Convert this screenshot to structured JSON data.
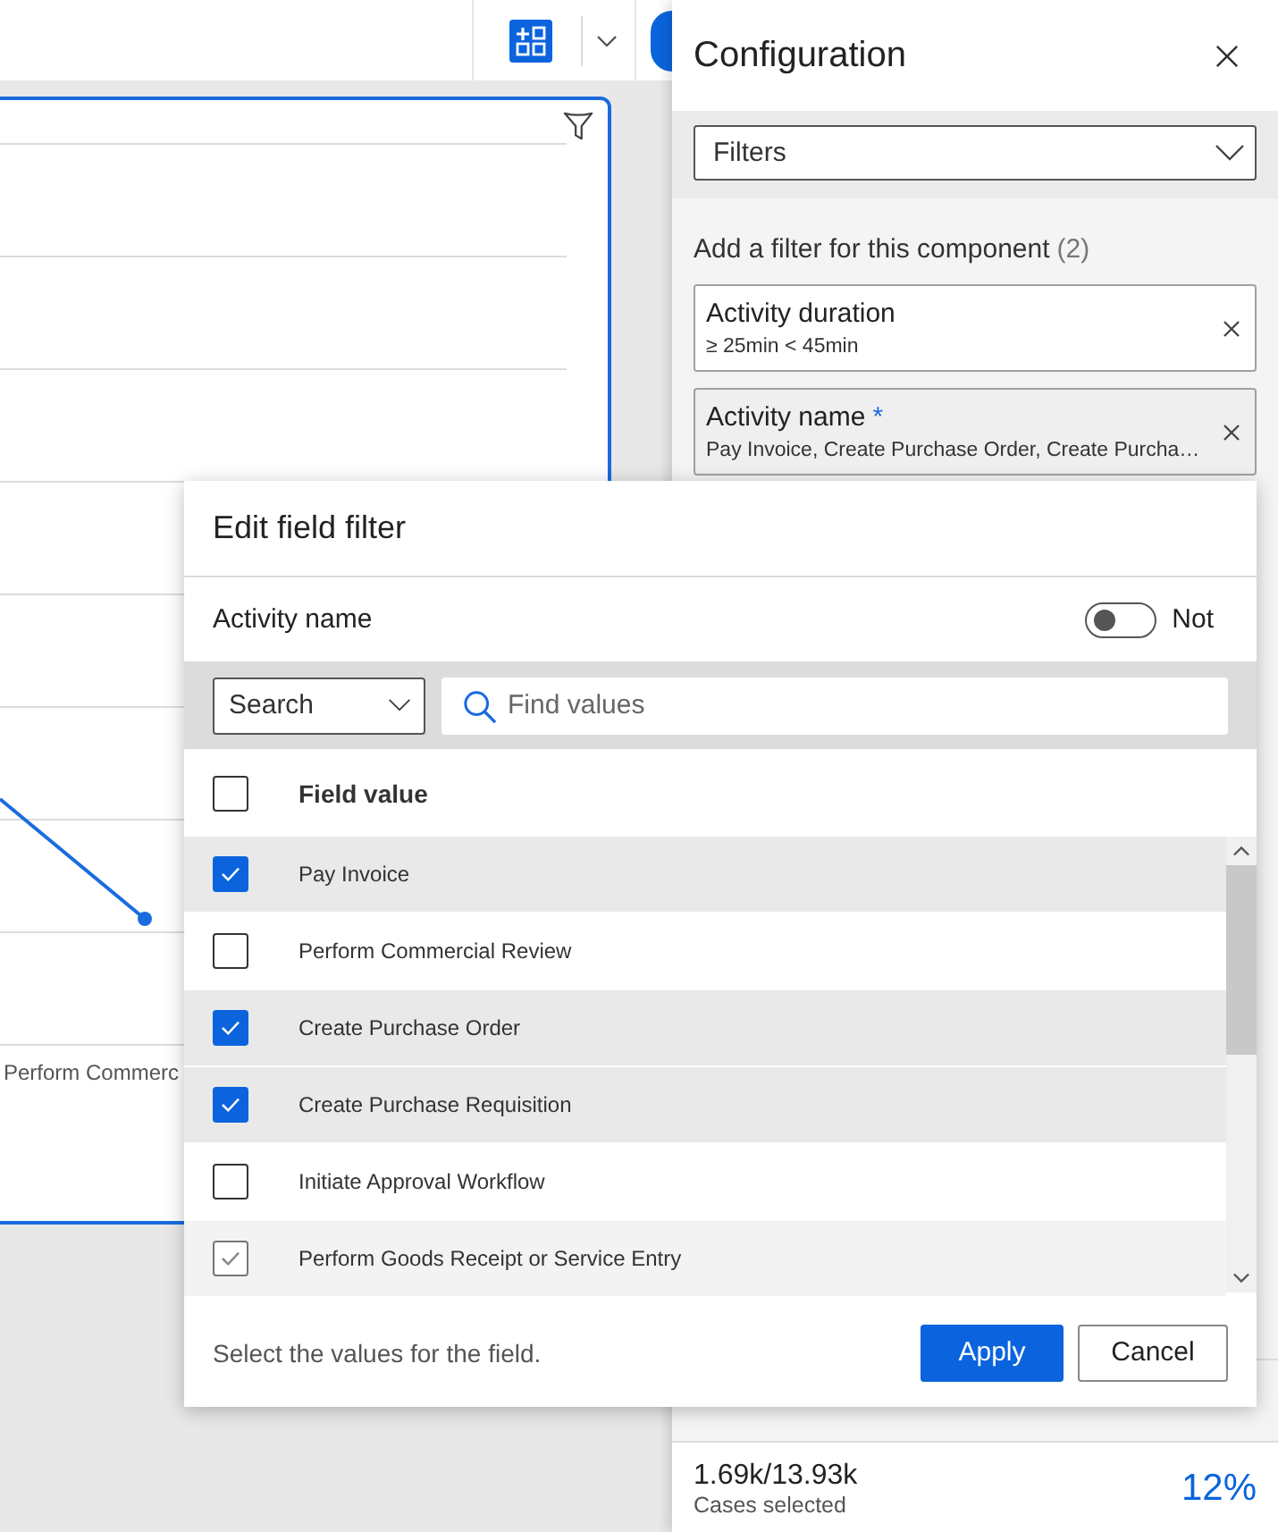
{
  "chart": {
    "axis_label": "Perform Commerc"
  },
  "configuration": {
    "title": "Configuration",
    "section_select": "Filters",
    "filters_heading": "Add a filter for this component",
    "filter_count": "(2)",
    "filters": [
      {
        "title": "Activity duration",
        "summary": "≥ 25min < 45min",
        "selected": false
      },
      {
        "title": "Activity name",
        "mark": "*",
        "summary": "Pay Invoice, Create Purchase Order, Create Purcha…",
        "selected": true
      }
    ],
    "cases": {
      "value": "1.69k/13.93k",
      "label": "Cases selected",
      "percent": "12%"
    }
  },
  "edit_filter": {
    "title": "Edit field filter",
    "field_name": "Activity name",
    "not_toggle": {
      "label": "Not",
      "on": false
    },
    "mode_select": "Search",
    "search": {
      "placeholder": "Find values"
    },
    "header": {
      "label": "Field value",
      "checked": false
    },
    "values": [
      {
        "label": "Pay Invoice",
        "checked": true,
        "disabled": false
      },
      {
        "label": "Perform Commercial Review",
        "checked": false,
        "disabled": false
      },
      {
        "label": "Create Purchase Order",
        "checked": true,
        "disabled": false
      },
      {
        "label": "Create Purchase Requisition",
        "checked": true,
        "disabled": false
      },
      {
        "label": "Initiate Approval Workflow",
        "checked": false,
        "disabled": false
      },
      {
        "label": "Perform Goods Receipt or Service Entry",
        "checked": true,
        "disabled": true
      }
    ],
    "hint": "Select the values for the field.",
    "buttons": [
      {
        "label": "Apply",
        "kind": "primary"
      },
      {
        "label": "Cancel",
        "kind": "secondary"
      }
    ]
  }
}
